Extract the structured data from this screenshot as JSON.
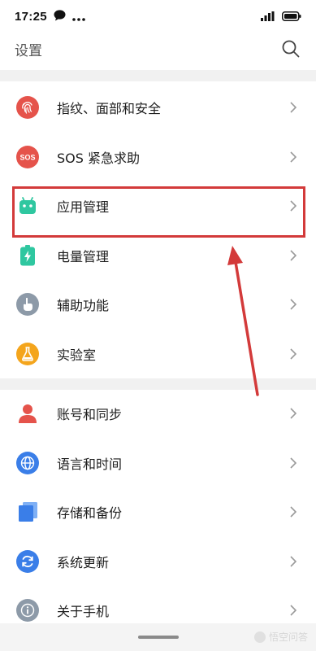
{
  "status_bar": {
    "time": "17:25",
    "icons": [
      "chat-bubble-icon",
      "more-dots-icon",
      "signal-icon",
      "battery-icon"
    ]
  },
  "header": {
    "title": "设置",
    "search_icon": "search-icon"
  },
  "settings": {
    "group1": [
      {
        "label": "指纹、面部和安全",
        "icon": "fingerprint-icon",
        "color": "#e5534b"
      },
      {
        "label": "SOS 紧急求助",
        "icon": "sos-icon",
        "color": "#e5534b"
      },
      {
        "label": "应用管理",
        "icon": "android-icon",
        "color": "#2fc7a0"
      },
      {
        "label": "电量管理",
        "icon": "battery-charge-icon",
        "color": "#2fc7a0"
      },
      {
        "label": "辅助功能",
        "icon": "hand-icon",
        "color": "#8d9aa8"
      },
      {
        "label": "实验室",
        "icon": "flask-icon",
        "color": "#f4a51c"
      }
    ],
    "group2": [
      {
        "label": "账号和同步",
        "icon": "person-icon",
        "color": "#e5534b"
      },
      {
        "label": "语言和时间",
        "icon": "globe-icon",
        "color": "#3a7ee8"
      },
      {
        "label": "存储和备份",
        "icon": "storage-icon",
        "color": "#3a7ee8"
      },
      {
        "label": "系统更新",
        "icon": "update-icon",
        "color": "#3a7ee8"
      },
      {
        "label": "关于手机",
        "icon": "info-icon",
        "color": "#8d9aa8"
      }
    ]
  },
  "annotation": {
    "highlight_color": "#d33a3a"
  },
  "watermark": {
    "text": "悟空问答"
  }
}
